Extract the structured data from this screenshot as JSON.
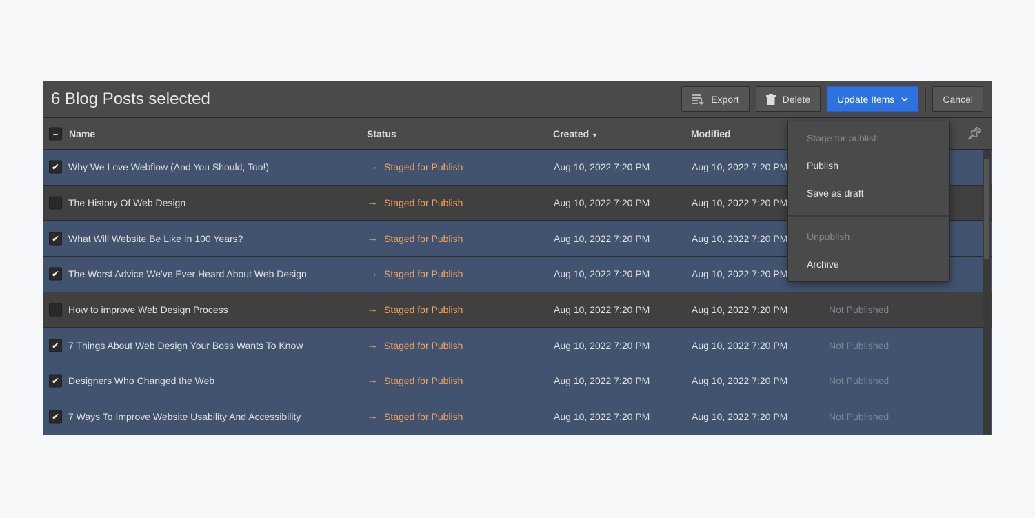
{
  "header": {
    "title": "6 Blog Posts selected",
    "export": "Export",
    "delete": "Delete",
    "update": "Update Items",
    "cancel": "Cancel"
  },
  "columns": {
    "name": "Name",
    "status": "Status",
    "created": "Created",
    "modified": "Modified",
    "sort_icon": "caret-down"
  },
  "rows": [
    {
      "name": "Why We Love Webflow (And You Should, Too!)",
      "status": "Staged for Publish",
      "created": "Aug 10, 2022 7:20 PM",
      "modified": "Aug 10, 2022 7:20 PM",
      "published": "",
      "checked": true
    },
    {
      "name": "The History Of Web Design",
      "status": "Staged for Publish",
      "created": "Aug 10, 2022 7:20 PM",
      "modified": "Aug 10, 2022 7:20 PM",
      "published": "",
      "checked": false
    },
    {
      "name": "What Will Website Be Like In 100 Years?",
      "status": "Staged for Publish",
      "created": "Aug 10, 2022 7:20 PM",
      "modified": "Aug 10, 2022 7:20 PM",
      "published": "",
      "checked": true
    },
    {
      "name": "The Worst Advice We've Ever Heard About Web Design",
      "status": "Staged for Publish",
      "created": "Aug 10, 2022 7:20 PM",
      "modified": "Aug 10, 2022 7:20 PM",
      "published": "",
      "checked": true
    },
    {
      "name": "How to improve Web Design Process",
      "status": "Staged for Publish",
      "created": "Aug 10, 2022 7:20 PM",
      "modified": "Aug 10, 2022 7:20 PM",
      "published": "Not Published",
      "checked": false
    },
    {
      "name": "7 Things About Web Design Your Boss Wants To Know",
      "status": "Staged for Publish",
      "created": "Aug 10, 2022 7:20 PM",
      "modified": "Aug 10, 2022 7:20 PM",
      "published": "Not Published",
      "checked": true
    },
    {
      "name": "Designers Who Changed the Web",
      "status": "Staged for Publish",
      "created": "Aug 10, 2022 7:20 PM",
      "modified": "Aug 10, 2022 7:20 PM",
      "published": "Not Published",
      "checked": true
    },
    {
      "name": "7 Ways To Improve Website Usability And Accessibility",
      "status": "Staged for Publish",
      "created": "Aug 10, 2022 7:20 PM",
      "modified": "Aug 10, 2022 7:20 PM",
      "published": "Not Published",
      "checked": true
    }
  ],
  "menu": {
    "items": [
      {
        "label": "Stage for publish",
        "disabled": true
      },
      {
        "label": "Publish",
        "disabled": false
      },
      {
        "label": "Save as draft",
        "disabled": false
      },
      {
        "label": "Unpublish",
        "disabled": true
      },
      {
        "label": "Archive",
        "disabled": false
      }
    ]
  },
  "colors": {
    "accent": "#2d72e0",
    "selected_row": "#41536f",
    "status": "#f4a45a"
  }
}
